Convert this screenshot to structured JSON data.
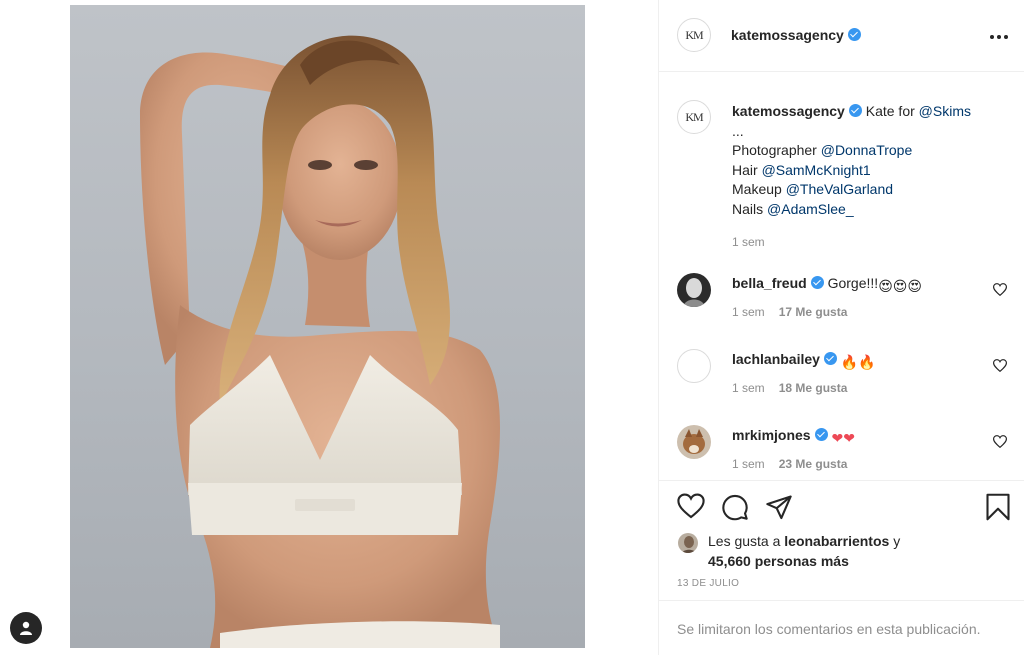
{
  "post": {
    "image_alt": "Kate Moss in white bralette on grey backdrop",
    "account": {
      "username": "katemossagency",
      "verified": true,
      "avatar_monogram": "KM"
    },
    "more_label": "•••",
    "caption": {
      "username": "katemossagency",
      "lead": "Kate for ",
      "lead_mention": "@Skims",
      "ellipsis": "...",
      "credits": [
        {
          "label": "Photographer ",
          "mention": "@DonnaTrope"
        },
        {
          "label": "Hair ",
          "mention": "@SamMcKnight1"
        },
        {
          "label": "Makeup ",
          "mention": "@TheValGarland"
        },
        {
          "label": "Nails ",
          "mention": "@AdamSlee_"
        }
      ],
      "time": "1 sem"
    },
    "comments": [
      {
        "username": "bella_freud",
        "text": "Gorge!!!",
        "emojis": "😍😍😍",
        "time": "1 sem",
        "likes": "17 Me gusta"
      },
      {
        "username": "lachlanbailey",
        "text": "",
        "emojis": "🔥🔥",
        "time": "1 sem",
        "likes": "18 Me gusta"
      },
      {
        "username": "mrkimjones",
        "text": "",
        "emojis": "❤❤",
        "time": "1 sem",
        "likes": "23 Me gusta"
      }
    ],
    "liked_by": {
      "prefix": "Les gusta a ",
      "user": "leonabarrientos",
      "conj": " y",
      "others": "45,660 personas más"
    },
    "date": "13 DE JULIO",
    "comments_limited": "Se limitaron los comentarios en esta publicación."
  },
  "icons": {
    "like": "heart-icon",
    "comment": "comment-icon",
    "share": "paper-plane-icon",
    "save": "bookmark-icon",
    "more": "more-horizontal-icon",
    "profile": "user-icon"
  },
  "colors": {
    "verified": "#3897f0",
    "mention": "#00376b",
    "muted": "#8e8e8e",
    "text": "#262626",
    "heart_red": "#ed4956",
    "border": "#efefef"
  }
}
